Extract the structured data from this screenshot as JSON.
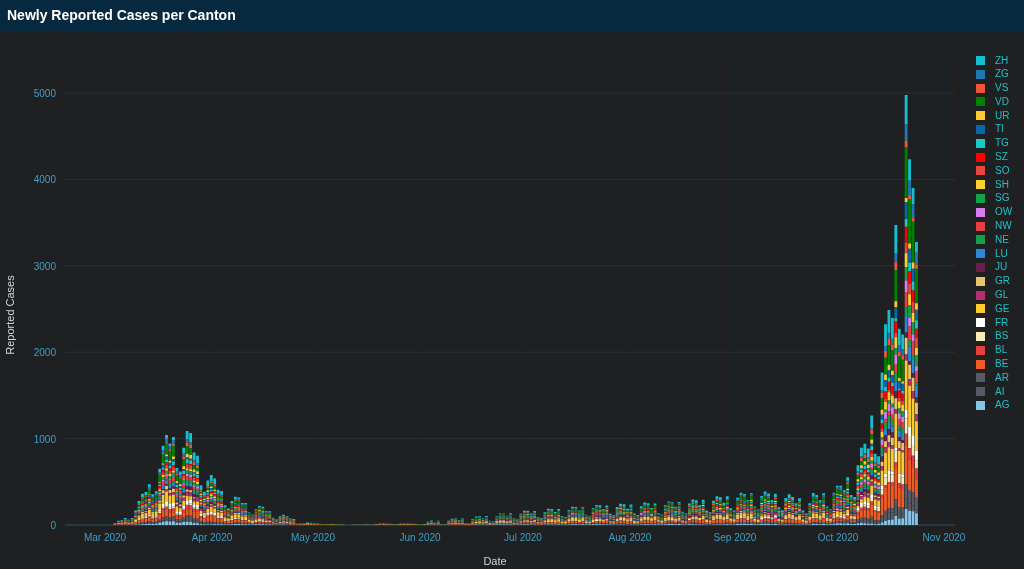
{
  "title": "Newly Reported Cases per Canton",
  "chart": {
    "xlabel": "Date",
    "ylabel": "Reported Cases",
    "yticks": [
      "5000",
      "4000",
      "3000",
      "2000",
      "1000",
      "0"
    ],
    "xticks": [
      "Mar 2020",
      "Apr 2020",
      "May 2020",
      "Jun 2020",
      "Jul 2020",
      "Aug 2020",
      "Sep 2020",
      "Oct 2020",
      "Nov 2020"
    ],
    "legend": [
      {
        "label": "ZH",
        "color": "#17becf"
      },
      {
        "label": "ZG",
        "color": "#1f77b4"
      },
      {
        "label": "VS",
        "color": "#ef553b"
      },
      {
        "label": "VD",
        "color": "#008000"
      },
      {
        "label": "UR",
        "color": "#fecb2f"
      },
      {
        "label": "TI",
        "color": "#0668a8"
      },
      {
        "label": "TG",
        "color": "#1acac0"
      },
      {
        "label": "SZ",
        "color": "#ff0000"
      },
      {
        "label": "SO",
        "color": "#e8453c"
      },
      {
        "label": "SH",
        "color": "#fcd02c"
      },
      {
        "label": "SG",
        "color": "#13a14a"
      },
      {
        "label": "OW",
        "color": "#d67ef0"
      },
      {
        "label": "NW",
        "color": "#e84040"
      },
      {
        "label": "NE",
        "color": "#14a04a"
      },
      {
        "label": "LU",
        "color": "#2b88d8"
      },
      {
        "label": "JU",
        "color": "#6a1e4e"
      },
      {
        "label": "GR",
        "color": "#e6c56e"
      },
      {
        "label": "GL",
        "color": "#b2306f"
      },
      {
        "label": "GE",
        "color": "#fcc92e"
      },
      {
        "label": "FR",
        "color": "#ffffff"
      },
      {
        "label": "BS",
        "color": "#f7ecb8"
      },
      {
        "label": "BL",
        "color": "#e64040"
      },
      {
        "label": "BE",
        "color": "#f15a22"
      },
      {
        "label": "AR",
        "color": "#565b66"
      },
      {
        "label": "AI",
        "color": "#555a64"
      },
      {
        "label": "AG",
        "color": "#86c5e8"
      }
    ]
  }
}
